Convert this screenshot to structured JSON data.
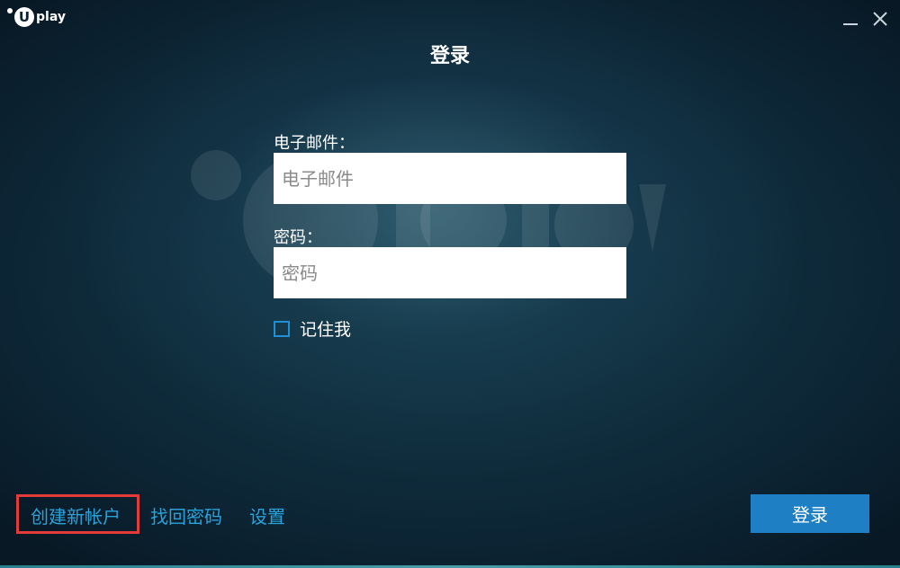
{
  "brand": {
    "logo_letter": "U",
    "logo_text": "play"
  },
  "window_controls": {
    "minimize_icon": "minimize-icon",
    "close_icon": "close-icon"
  },
  "title": "登录",
  "form": {
    "email_label": "电子邮件：",
    "email_placeholder": "电子邮件",
    "email_value": "",
    "password_label": "密码：",
    "password_placeholder": "密码",
    "password_value": "",
    "remember_label": "记住我",
    "remember_checked": false
  },
  "footer": {
    "create_account": "创建新帐户",
    "recover_password": "找回密码",
    "settings": "设置",
    "login_button": "登录"
  },
  "colors": {
    "accent": "#1f7fc4",
    "link": "#28a3dc",
    "highlight": "#e53a3a",
    "background": "#0c1f2c"
  }
}
